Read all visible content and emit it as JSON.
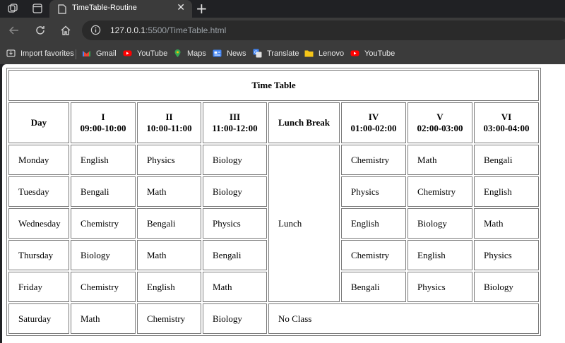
{
  "browser": {
    "tab_title": "TimeTable-Routine",
    "url_host": "127.0.0.1",
    "url_rest": ":5500/TimeTable.html",
    "bookmarks": [
      "Import favorites",
      "Gmail",
      "YouTube",
      "Maps",
      "News",
      "Translate",
      "Lenovo",
      "YouTube"
    ]
  },
  "table": {
    "title": "Time Table",
    "head": {
      "day": "Day",
      "lunch": "Lunch Break",
      "periods": [
        {
          "num": "I",
          "time": "09:00-10:00"
        },
        {
          "num": "II",
          "time": "10:00-11:00"
        },
        {
          "num": "III",
          "time": "11:00-12:00"
        },
        {
          "num": "IV",
          "time": "01:00-02:00"
        },
        {
          "num": "V",
          "time": "02:00-03:00"
        },
        {
          "num": "VI",
          "time": "03:00-04:00"
        }
      ]
    },
    "lunch_text": "Lunch",
    "no_class_text": "No Class",
    "rows": [
      {
        "day": "Monday",
        "before": [
          "English",
          "Physics",
          "Biology"
        ],
        "after": [
          "Chemistry",
          "Math",
          "Bengali"
        ]
      },
      {
        "day": "Tuesday",
        "before": [
          "Bengali",
          "Math",
          "Biology"
        ],
        "after": [
          "Physics",
          "Chemistry",
          "English"
        ]
      },
      {
        "day": "Wednesday",
        "before": [
          "Chemistry",
          "Bengali",
          "Physics"
        ],
        "after": [
          "English",
          "Biology",
          "Math"
        ]
      },
      {
        "day": "Thursday",
        "before": [
          "Biology",
          "Math",
          "Bengali"
        ],
        "after": [
          "Chemistry",
          "English",
          "Physics"
        ]
      },
      {
        "day": "Friday",
        "before": [
          "Chemistry",
          "English",
          "Math"
        ],
        "after": [
          "Bengali",
          "Physics",
          "Biology"
        ]
      },
      {
        "day": "Saturday",
        "before": [
          "Math",
          "Chemistry",
          "Biology"
        ],
        "after": []
      }
    ]
  }
}
